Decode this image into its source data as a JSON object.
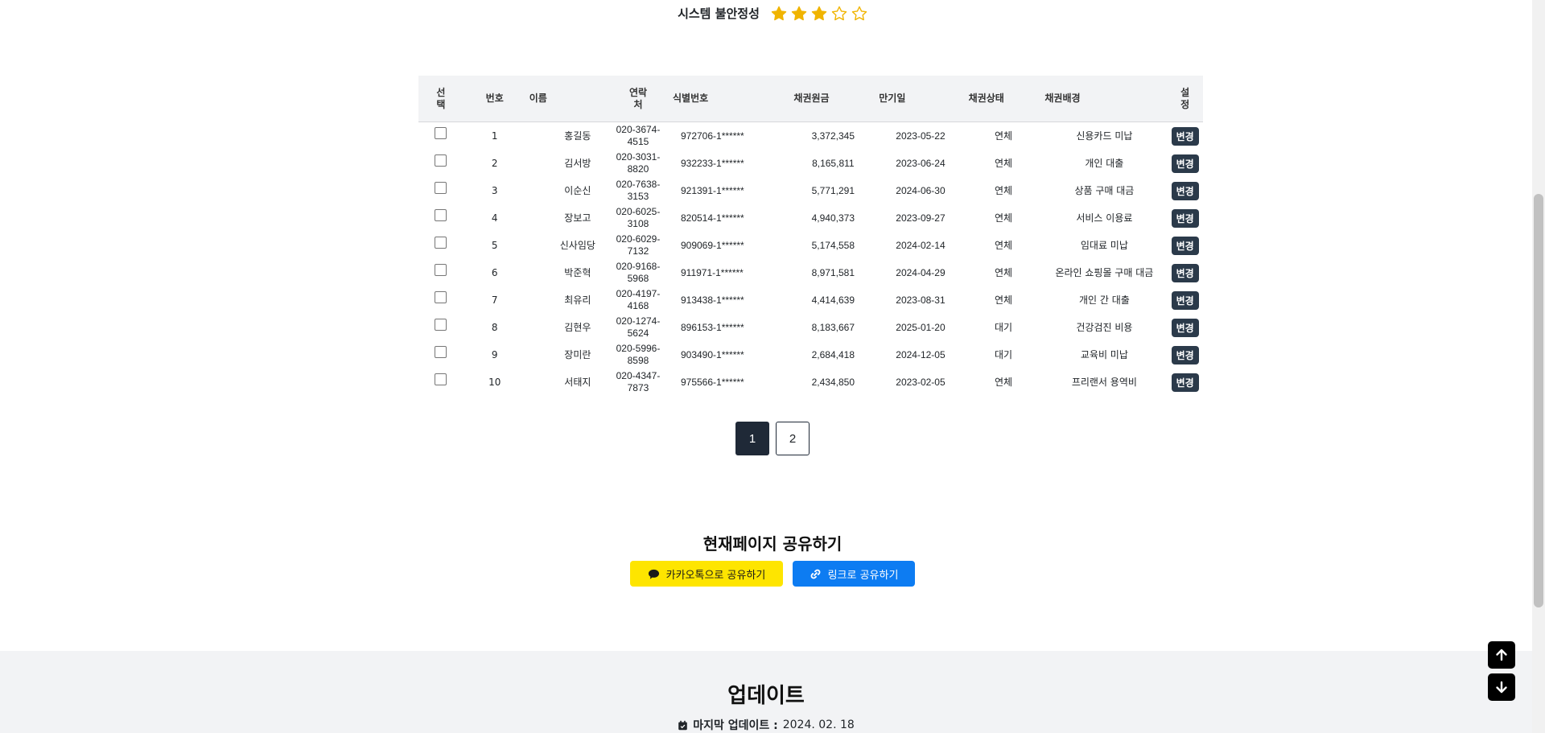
{
  "stability": {
    "label": "시스템 불안정성",
    "rating": 3,
    "max_rating": 5,
    "star_color": "#f0b400"
  },
  "table": {
    "headers": {
      "select": "선택",
      "no": "번호",
      "name": "이름",
      "contact": "연락처",
      "id_number": "식별번호",
      "principal": "채권원금",
      "due_date": "만기일",
      "status": "채권상태",
      "background": "채권배경",
      "settings": "설정"
    },
    "change_label": "변경",
    "rows": [
      {
        "no": "1",
        "name": "홍길동",
        "phone_a": "020-3674-",
        "phone_b": "4515",
        "id": "972706-1******",
        "principal": "3,372,345",
        "due": "2023-05-22",
        "status": "연체",
        "background": "신용카드 미납"
      },
      {
        "no": "2",
        "name": "김서방",
        "phone_a": "020-3031-",
        "phone_b": "8820",
        "id": "932233-1******",
        "principal": "8,165,811",
        "due": "2023-06-24",
        "status": "연체",
        "background": "개인 대출"
      },
      {
        "no": "3",
        "name": "이순신",
        "phone_a": "020-7638-",
        "phone_b": "3153",
        "id": "921391-1******",
        "principal": "5,771,291",
        "due": "2024-06-30",
        "status": "연체",
        "background": "상품 구매 대금"
      },
      {
        "no": "4",
        "name": "장보고",
        "phone_a": "020-6025-",
        "phone_b": "3108",
        "id": "820514-1******",
        "principal": "4,940,373",
        "due": "2023-09-27",
        "status": "연체",
        "background": "서비스 이용료"
      },
      {
        "no": "5",
        "name": "신사임당",
        "phone_a": "020-6029-",
        "phone_b": "7132",
        "id": "909069-1******",
        "principal": "5,174,558",
        "due": "2024-02-14",
        "status": "연체",
        "background": "임대료 미납"
      },
      {
        "no": "6",
        "name": "박준혁",
        "phone_a": "020-9168-",
        "phone_b": "5968",
        "id": "911971-1******",
        "principal": "8,971,581",
        "due": "2024-04-29",
        "status": "연체",
        "background": "온라인 쇼핑몰 구매 대금"
      },
      {
        "no": "7",
        "name": "최유리",
        "phone_a": "020-4197-",
        "phone_b": "4168",
        "id": "913438-1******",
        "principal": "4,414,639",
        "due": "2023-08-31",
        "status": "연체",
        "background": "개인 간 대출"
      },
      {
        "no": "8",
        "name": "김현우",
        "phone_a": "020-1274-",
        "phone_b": "5624",
        "id": "896153-1******",
        "principal": "8,183,667",
        "due": "2025-01-20",
        "status": "대기",
        "background": "건강검진 비용"
      },
      {
        "no": "9",
        "name": "장미란",
        "phone_a": "020-5996-",
        "phone_b": "8598",
        "id": "903490-1******",
        "principal": "2,684,418",
        "due": "2024-12-05",
        "status": "대기",
        "background": "교육비 미납"
      },
      {
        "no": "10",
        "name": "서태지",
        "phone_a": "020-4347-",
        "phone_b": "7873",
        "id": "975566-1******",
        "principal": "2,434,850",
        "due": "2023-02-05",
        "status": "연체",
        "background": "프리랜서 용역비"
      }
    ]
  },
  "pagination": {
    "pages": [
      "1",
      "2"
    ],
    "current": "1"
  },
  "share": {
    "title": "현재페이지 공유하기",
    "kakao_label": "카카오톡으로 공유하기",
    "link_label": "링크로 공유하기",
    "kakao_color": "#fee500",
    "link_color": "#0d7cf2"
  },
  "footer": {
    "title": "업데이트",
    "last_update_label": "마지막 업데이트 :",
    "last_update_value": "2024. 02. 18"
  },
  "icons": {
    "star_filled": "star-filled-icon",
    "star_empty": "star-outline-icon",
    "kakao": "chat-bubble-icon",
    "link": "link-icon",
    "calendar": "calendar-check-icon",
    "scroll_up": "arrow-up-icon",
    "scroll_down": "arrow-down-icon"
  }
}
